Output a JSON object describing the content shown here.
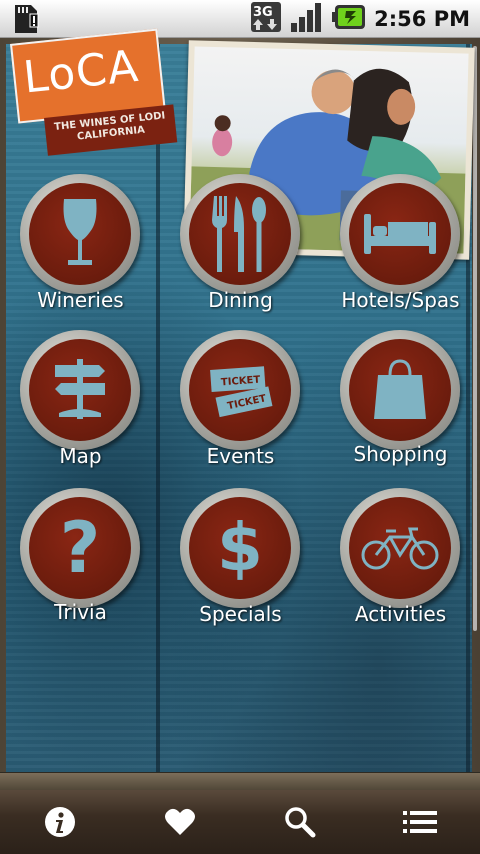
{
  "status_bar": {
    "time": "2:56 PM",
    "network": "3G",
    "icons": [
      "sd-card-warning-icon",
      "3g-data-icon",
      "signal-icon",
      "battery-charging-icon"
    ]
  },
  "logo": {
    "title": "LoCA",
    "subtitle": "THE WINES OF LODI CALIFORNIA"
  },
  "menu": [
    {
      "label": "Wineries",
      "icon": "wine-glass-icon"
    },
    {
      "label": "Dining",
      "icon": "fork-knife-spoon-icon"
    },
    {
      "label": "Hotels/Spas",
      "icon": "bed-icon"
    },
    {
      "label": "Map",
      "icon": "signpost-icon"
    },
    {
      "label": "Events",
      "icon": "ticket-icon"
    },
    {
      "label": "Shopping",
      "icon": "shopping-bag-icon"
    },
    {
      "label": "Trivia",
      "icon": "question-mark-icon"
    },
    {
      "label": "Specials",
      "icon": "dollar-sign-icon"
    },
    {
      "label": "Activities",
      "icon": "bicycle-icon"
    }
  ],
  "bottom_nav": [
    "info-icon",
    "heart-icon",
    "search-icon",
    "list-icon"
  ],
  "colors": {
    "logo_orange": "#e5712c",
    "logo_red": "#7b2211",
    "button_red": "#6b1c0d",
    "icon_blue": "#7fb3c3",
    "wall_blue": "#2f6f8a"
  }
}
